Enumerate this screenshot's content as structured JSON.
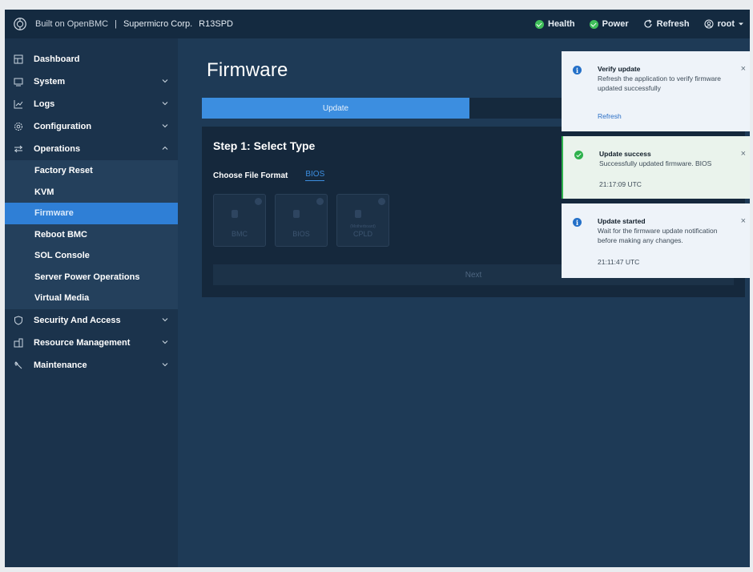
{
  "header": {
    "logo_icon": "openbmc-logo-icon",
    "built_on": "Built on OpenBMC",
    "separator": "|",
    "vendor": "Supermicro Corp.",
    "hostname": "R13SPD",
    "health_label": "Health",
    "power_label": "Power",
    "refresh_label": "Refresh",
    "user_label": "root",
    "status_color": "#3fbf5a"
  },
  "sidebar": {
    "items": [
      {
        "label": "Dashboard",
        "icon": "dashboard-icon"
      },
      {
        "label": "System",
        "icon": "monitor-icon"
      },
      {
        "label": "Logs",
        "icon": "chart-icon"
      },
      {
        "label": "Configuration",
        "icon": "gear-icon"
      },
      {
        "label": "Operations",
        "icon": "sliders-icon"
      },
      {
        "label": "Security And Access",
        "icon": "shield-icon"
      },
      {
        "label": "Resource Management",
        "icon": "building-icon"
      },
      {
        "label": "Maintenance",
        "icon": "wrench-icon"
      }
    ],
    "operations_sub": [
      {
        "label": "Factory Reset"
      },
      {
        "label": "KVM"
      },
      {
        "label": "Firmware",
        "active": true
      },
      {
        "label": "Reboot BMC"
      },
      {
        "label": "SOL Console"
      },
      {
        "label": "Server Power Operations"
      },
      {
        "label": "Virtual Media"
      }
    ]
  },
  "main": {
    "title": "Firmware",
    "tabs": [
      {
        "label": "Update",
        "active": true
      },
      {
        "label": "",
        "active": false
      }
    ],
    "step_title": "Step 1: Select Type",
    "format_label": "Choose File Format",
    "format_value": "BIOS",
    "types": [
      {
        "label": "BMC",
        "sub": ""
      },
      {
        "label": "BIOS",
        "sub": ""
      },
      {
        "label": "CPLD",
        "sub": "(Motherboard)"
      }
    ],
    "next_label": "Next"
  },
  "toasts": [
    {
      "kind": "info",
      "title": "Verify update",
      "body": "Refresh the application to verify firmware updated successfully",
      "link": "Refresh",
      "close": "×"
    },
    {
      "kind": "success",
      "title": "Update success",
      "body": "Successfully updated firmware. BIOS",
      "time": "21:17:09 UTC",
      "close": "×"
    },
    {
      "kind": "info",
      "title": "Update started",
      "body": "Wait for the firmware update notification before making any changes.",
      "time": "21:11:47 UTC",
      "close": "×"
    }
  ],
  "colors": {
    "accent": "#3c8ee0",
    "active_nav": "#2f7fd6",
    "sidebar_bg": "#1b334c",
    "content_bg": "#1e3a56",
    "success": "#2eb14c",
    "info": "#2470c8"
  }
}
